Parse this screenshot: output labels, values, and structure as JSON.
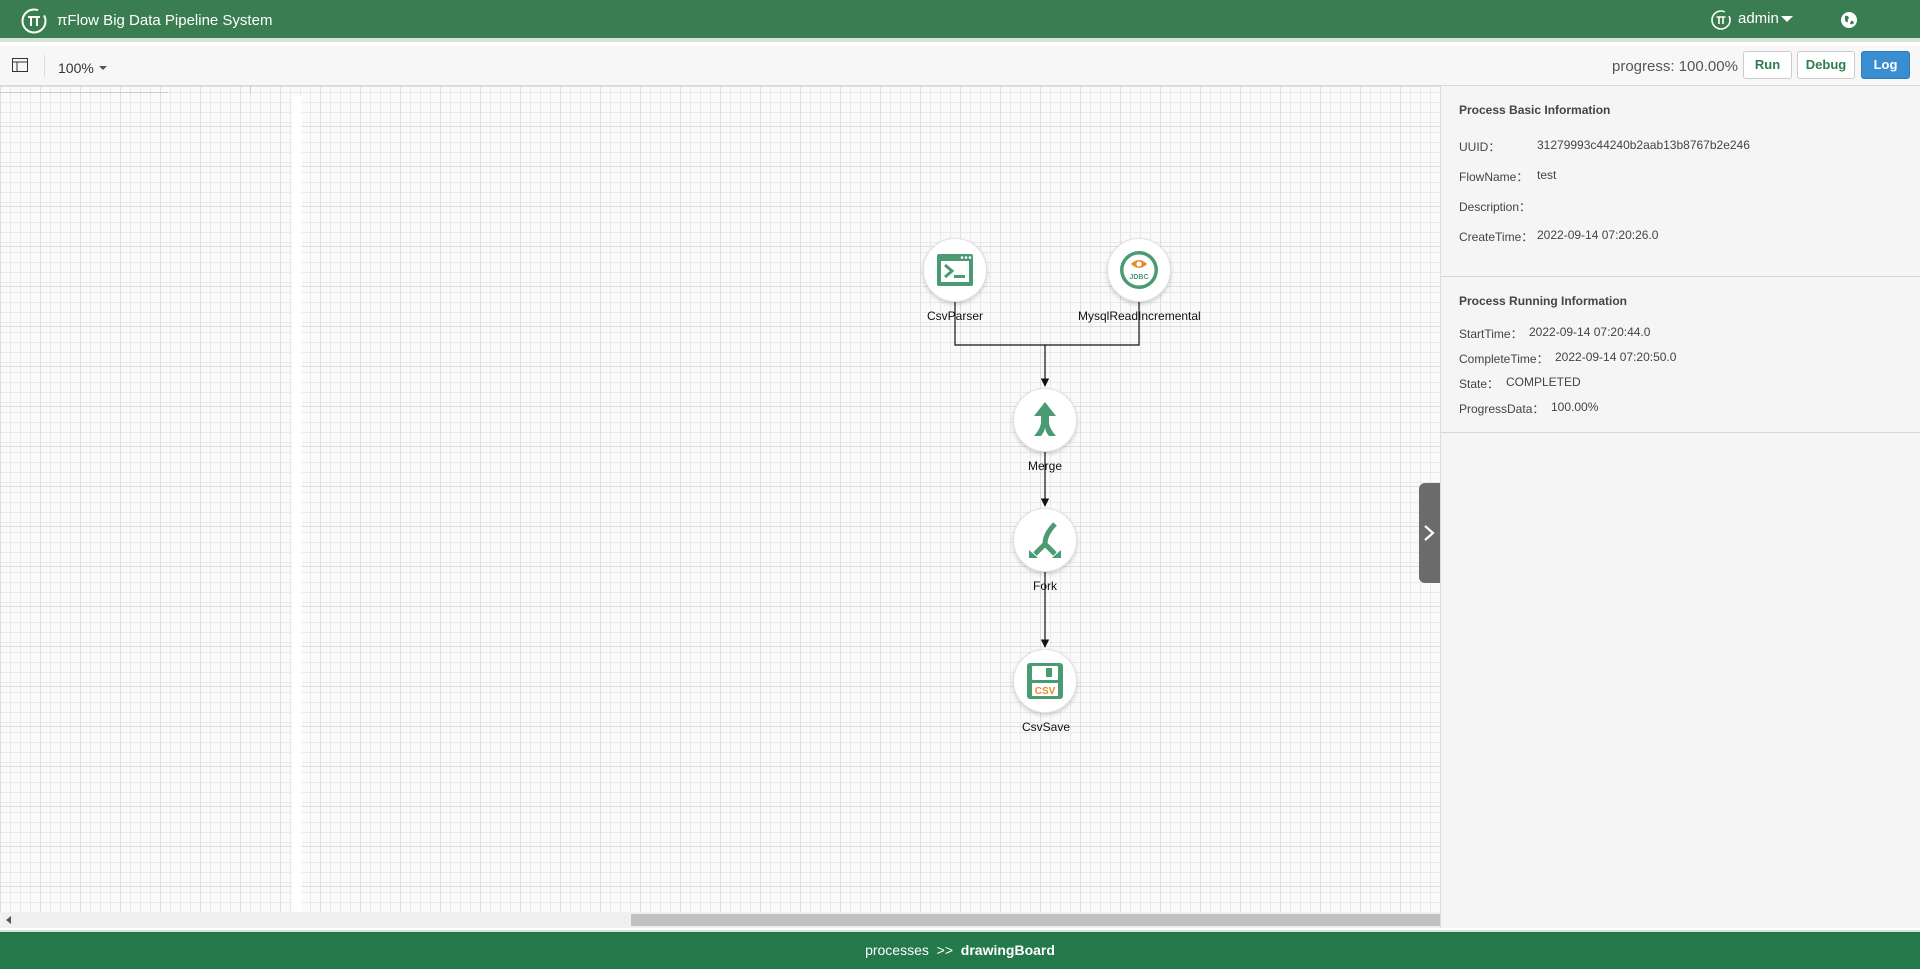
{
  "header": {
    "title": "πFlow Big Data Pipeline System",
    "user": "admin"
  },
  "toolbar": {
    "zoom": "100%",
    "progress_text": "progress: 100.00%",
    "run_label": "Run",
    "debug_label": "Debug",
    "log_label": "Log"
  },
  "flow": {
    "nodes": [
      {
        "name": "CsvParser",
        "icon": "terminal-window-icon"
      },
      {
        "name": "MysqlReadIncremental",
        "icon": "jdbc-eye-icon",
        "badge": "JDBC"
      },
      {
        "name": "Merge",
        "icon": "merge-arrow-icon"
      },
      {
        "name": "Fork",
        "icon": "fork-arrow-icon"
      },
      {
        "name": "CsvSave",
        "icon": "floppy-csv-icon",
        "badge": "CSV"
      }
    ],
    "edges": [
      [
        "CsvParser",
        "Merge"
      ],
      [
        "MysqlReadIncremental",
        "Merge"
      ],
      [
        "Merge",
        "Fork"
      ],
      [
        "Fork",
        "CsvSave"
      ]
    ]
  },
  "info": {
    "basic_title": "Process Basic Information",
    "uuid_label": "UUID：",
    "uuid_value": "31279993c44240b2aab13b8767b2e246",
    "flowname_label": "FlowName：",
    "flowname_value": "test",
    "description_label": "Description：",
    "description_value": "",
    "createtime_label": "CreateTime：",
    "createtime_value": "2022-09-14 07:20:26.0",
    "running_title": "Process Running Information",
    "starttime_label": "StartTime：",
    "starttime_value": "2022-09-14 07:20:44.0",
    "completetime_label": "CompleteTime：",
    "completetime_value": "2022-09-14 07:20:50.0",
    "state_label": "State：",
    "state_value": "COMPLETED",
    "progress_label": "ProgressData：",
    "progress_value": "100.00%"
  },
  "footer": {
    "path": "processes",
    "separator": ">>",
    "current": "drawingBoard"
  },
  "colors": {
    "header_green": "#3a7d50",
    "footer_green": "#24794a",
    "icon_green": "#4a9a72",
    "icon_orange": "#e8892b",
    "log_blue": "#3a8ed0"
  }
}
